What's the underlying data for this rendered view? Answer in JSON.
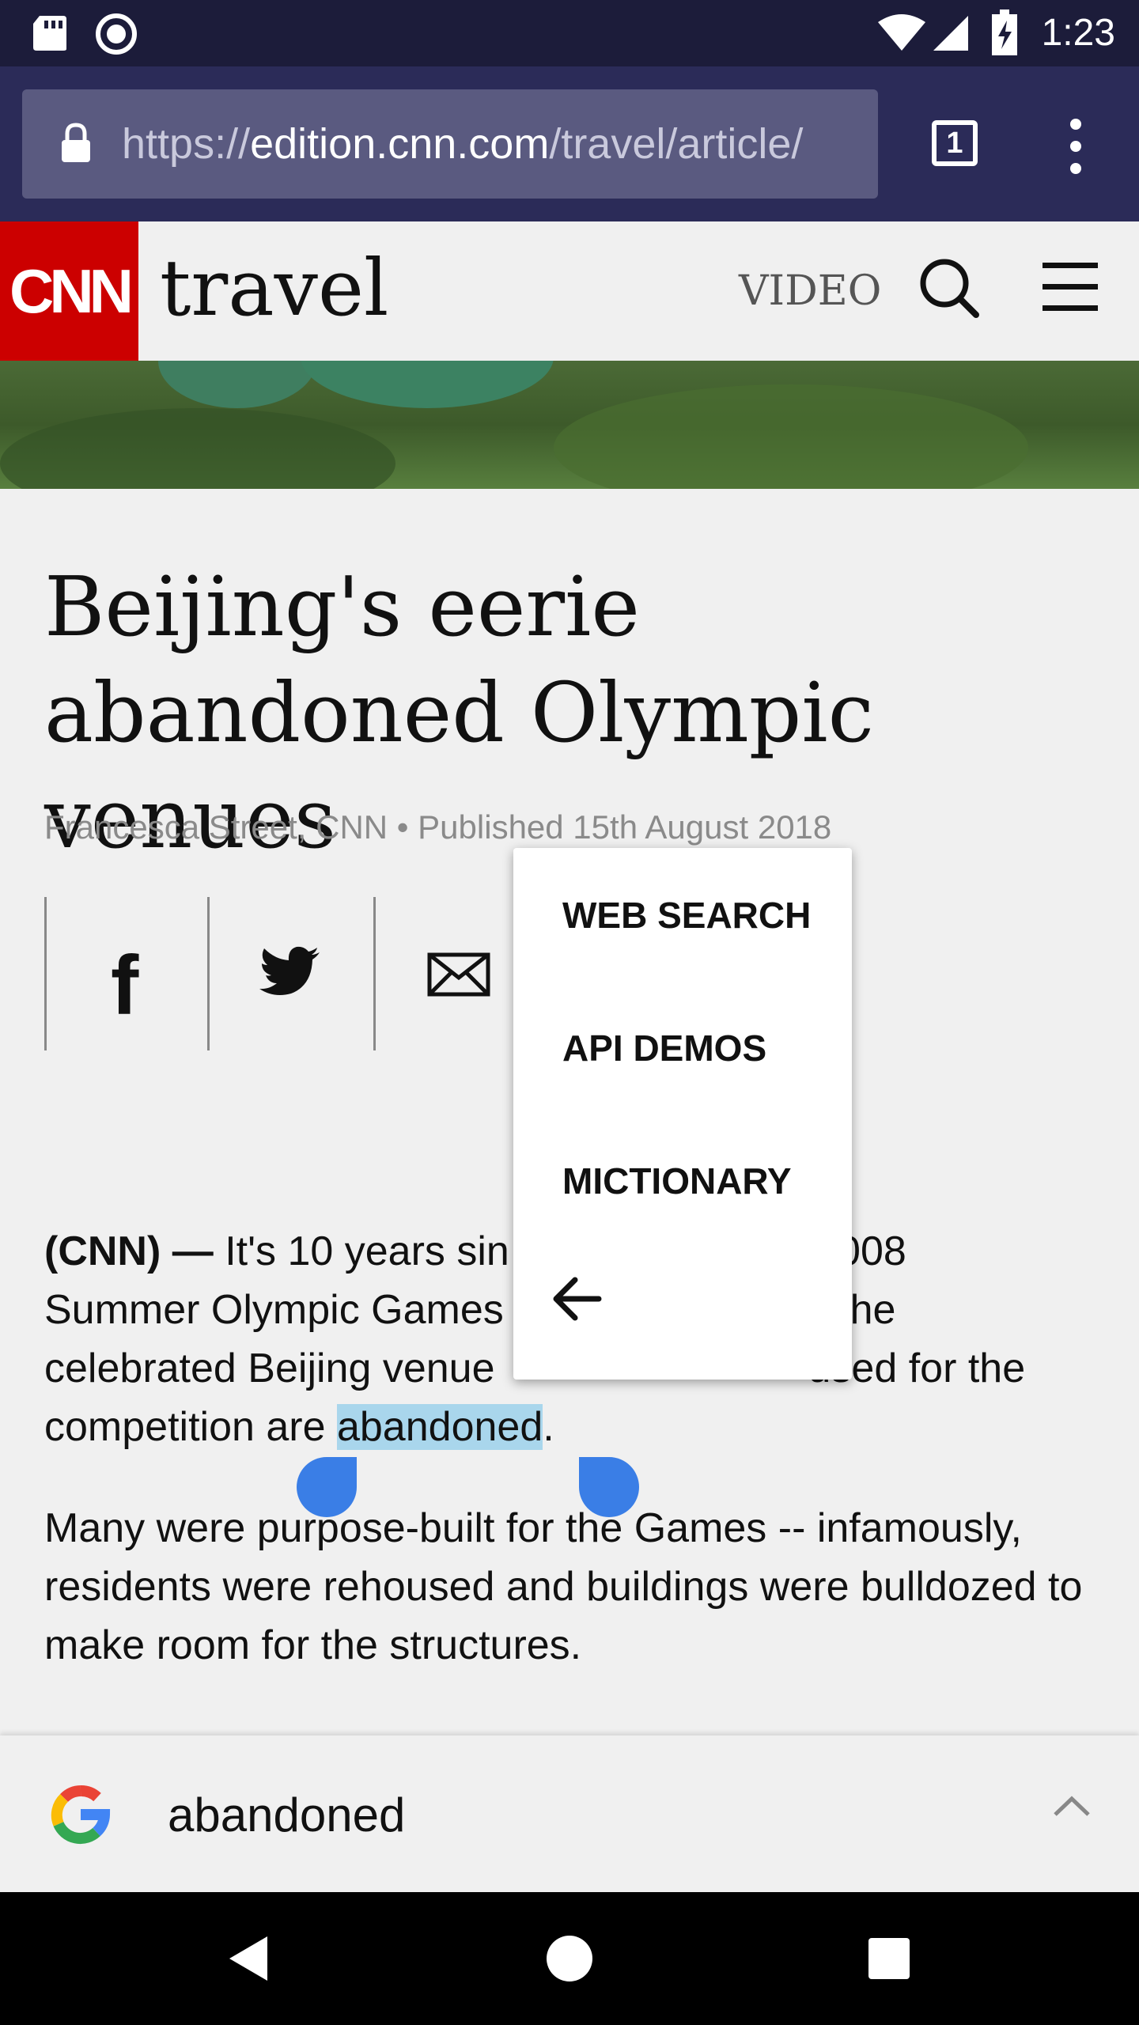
{
  "status_bar": {
    "time": "1:23"
  },
  "browser": {
    "url_prefix": "https://",
    "url_host": "edition.cnn.com",
    "url_path": "/travel/article/",
    "tab_count": "1"
  },
  "site_header": {
    "logo_text": "CNN",
    "section": "travel",
    "video_label": "VIDEO"
  },
  "article": {
    "headline": "Beijing's eerie abandoned Olympic venues",
    "byline": "Francesca Street, CNN • Published 15th August 2018",
    "p1_dateline": "(CNN) — ",
    "p1_before": "It's 10 years since ",
    "p1_mid_hidden": "the 2008 Summer Olympic Games ",
    "p1_visible_line1": "It's 10 years sin",
    "p1_line1_end": "he 2008",
    "p1_line2a": "Summer Olympic Games",
    "p1_line2b": "many of the",
    "p1_line3a": "celebrated Beijing venue",
    "p1_line3b": "used for the",
    "p1_line4a": "competition are ",
    "p1_selected": "abandoned",
    "p1_line4b": ".",
    "p2": "Many were purpose-built for the Games -- infamously, residents were rehoused and buildings were bulldozed to make room for the structures."
  },
  "popup_menu": {
    "items": [
      "WEB SEARCH",
      "API DEMOS",
      "MICTIONARY"
    ],
    "back_icon": "arrow-left-icon"
  },
  "google_bar": {
    "query": "abandoned"
  },
  "colors": {
    "cnn_red": "#cc0000",
    "toolbar": "#2b2b58",
    "selection": "#a9d6ec",
    "handle": "#3a7ee6"
  }
}
